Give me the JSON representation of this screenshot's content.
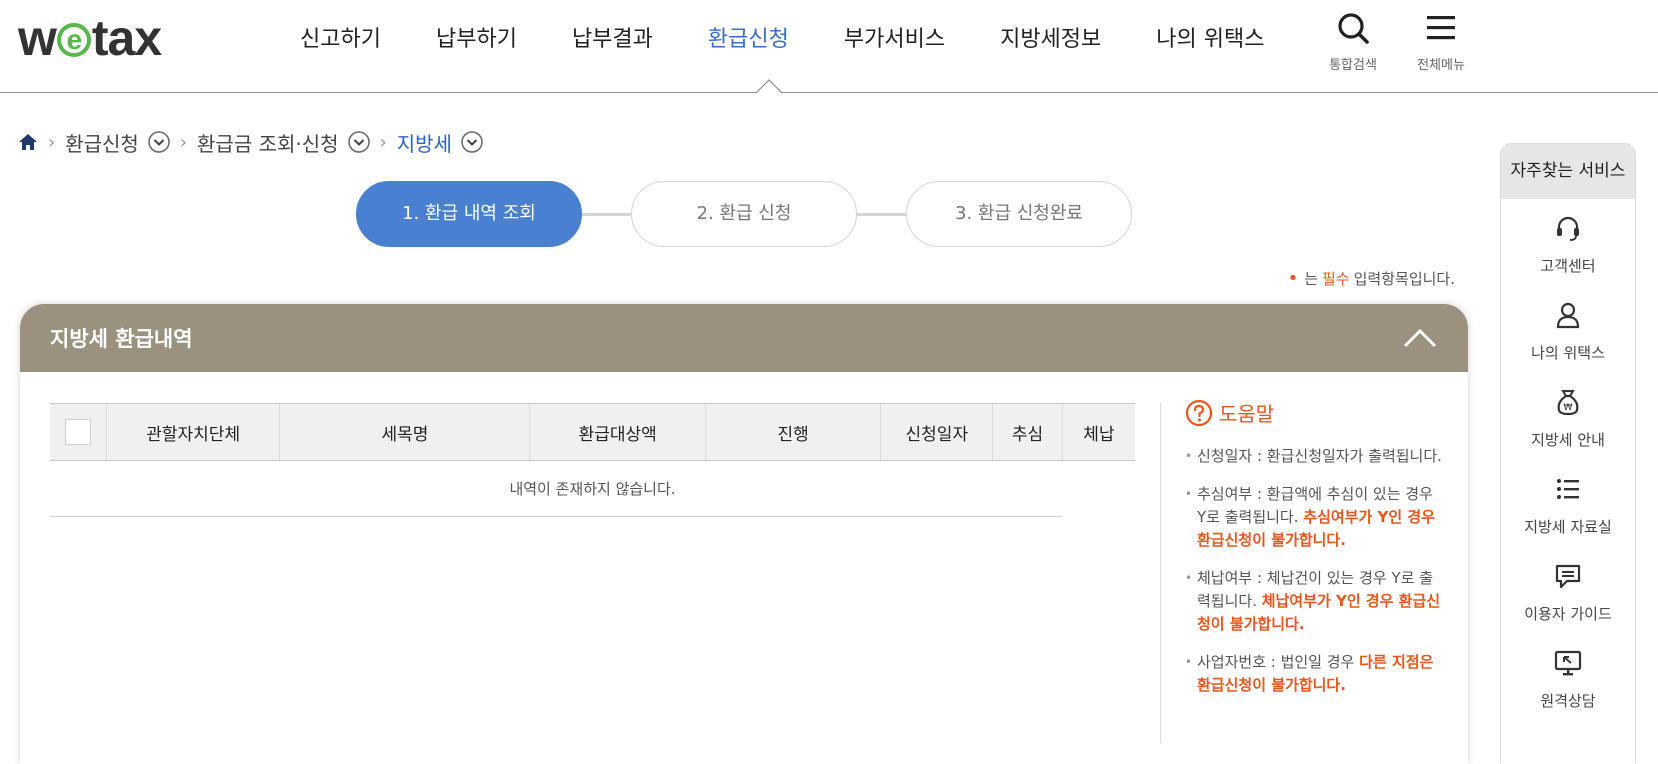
{
  "header": {
    "logo": {
      "before": "w",
      "circle": "e",
      "after": "tax"
    },
    "nav": [
      "신고하기",
      "납부하기",
      "납부결과",
      "환급신청",
      "부가서비스",
      "지방세정보",
      "나의 위택스"
    ],
    "active_nav": "환급신청",
    "search_label": "통합검색",
    "menu_label": "전체메뉴"
  },
  "breadcrumb": {
    "items": [
      "환급신청",
      "환급금 조회·신청",
      "지방세"
    ]
  },
  "steps": [
    "1. 환급 내역 조회",
    "2. 환급 신청",
    "3. 환급 신청완료"
  ],
  "required_note": {
    "required": "필수",
    "text": "입력항목입니다.",
    "prefix": "는"
  },
  "panel": {
    "title": "지방세 환급내역",
    "table": {
      "headers": [
        "관할자치단체",
        "세목명",
        "환급대상액",
        "진행",
        "신청일자",
        "추심",
        "체납"
      ],
      "empty_message": "내역이 존재하지 않습니다."
    },
    "help": {
      "title": "도움말",
      "items": [
        {
          "text": "신청일자 : 환급신청일자가 출력됩니다.",
          "warn": ""
        },
        {
          "text": "추심여부 : 환급액에 추심이 있는 경우 Y로 출력됩니다. ",
          "warn": "추심여부가 Y인 경우 환급신청이 불가합니다."
        },
        {
          "text": "체납여부 : 체납건이 있는 경우 Y로 출력됩니다. ",
          "warn": "체납여부가 Y인 경우 환급신청이 불가합니다."
        },
        {
          "text": "사업자번호 : 법인일 경우 ",
          "warn": "다른 지점은 환급신청이 불가합니다."
        }
      ]
    }
  },
  "quick_menu": {
    "title": "자주찾는 서비스",
    "items": [
      {
        "label": "고객센터",
        "icon": "headset-icon"
      },
      {
        "label": "나의 위택스",
        "icon": "person-icon"
      },
      {
        "label": "지방세 안내",
        "icon": "money-bag-icon"
      },
      {
        "label": "지방세 자료실",
        "icon": "list-icon"
      },
      {
        "label": "이용자 가이드",
        "icon": "chat-icon"
      },
      {
        "label": "원격상담",
        "icon": "monitor-icon"
      }
    ]
  },
  "colors": {
    "accent_blue": "#4a80d0",
    "active_nav": "#3a6fc4",
    "panel_header": "#9a917f",
    "warning": "#e8571d",
    "logo_green": "#56b848"
  }
}
